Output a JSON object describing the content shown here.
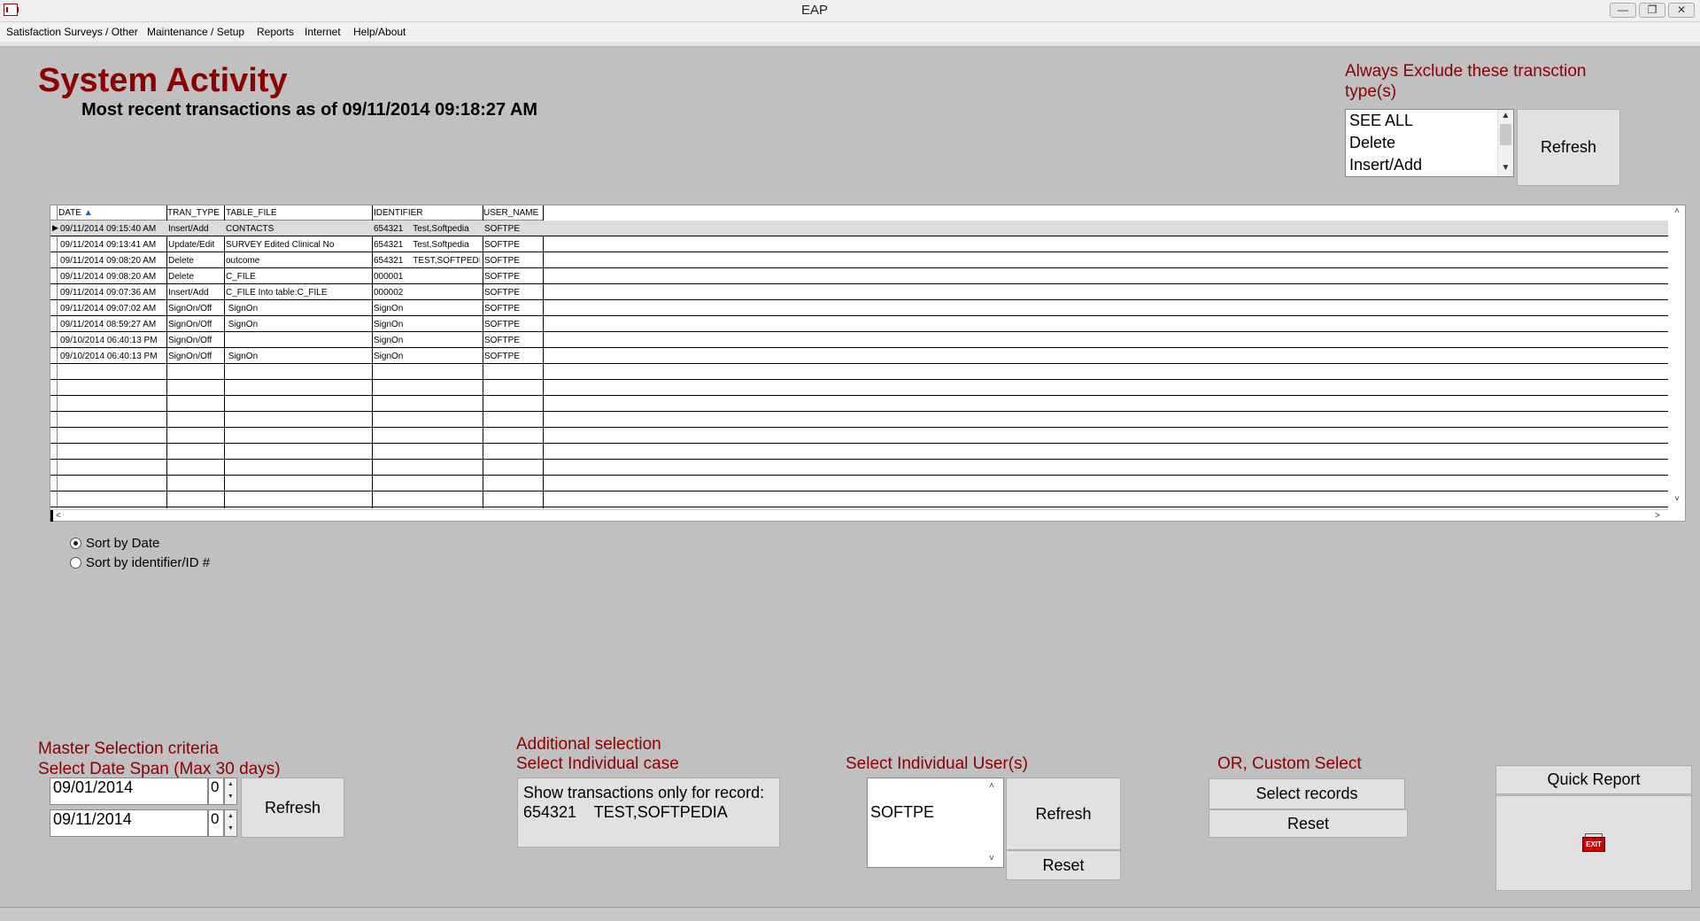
{
  "window": {
    "title": "EAP"
  },
  "menu": [
    "Satisfaction Surveys / Other",
    "Maintenance / Setup",
    "Reports",
    "Internet",
    "Help/About"
  ],
  "header": {
    "title": "System Activity",
    "subtitle": "Most recent transactions as of 09/11/2014 09:18:27 AM"
  },
  "exclude": {
    "label": "Always Exclude these transction type(s)",
    "options": [
      "SEE ALL",
      "Delete",
      "Insert/Add"
    ],
    "refresh_label": "Refresh"
  },
  "grid": {
    "columns": [
      "DATE",
      "TRAN_TYPE",
      "TABLE_FILE",
      "IDENTIFIER",
      "USER_NAME"
    ],
    "rows": [
      [
        "09/11/2014 09:15:40 AM",
        "Insert/Add",
        "CONTACTS",
        "654321    Test,Softpedia",
        "SOFTPE"
      ],
      [
        "09/11/2014 09:13:41 AM",
        "Update/Edit",
        "SURVEY Edited Clinical No",
        "654321    Test,Softpedia",
        "SOFTPE"
      ],
      [
        "09/11/2014 09:08:20 AM",
        "Delete",
        "outcome",
        "654321    TEST,SOFTPEDI",
        "SOFTPE"
      ],
      [
        "09/11/2014 09:08:20 AM",
        "Delete",
        "C_FILE",
        "000001",
        "SOFTPE"
      ],
      [
        "09/11/2014 09:07:36 AM",
        "Insert/Add",
        "C_FILE Into table:C_FILE",
        "000002",
        "SOFTPE"
      ],
      [
        "09/11/2014 09:07:02 AM",
        "SignOn/Off",
        " SignOn",
        "SignOn",
        "SOFTPE"
      ],
      [
        "09/11/2014 08:59:27 AM",
        "SignOn/Off",
        " SignOn",
        "SignOn",
        "SOFTPE"
      ],
      [
        "09/10/2014 06:40:13 PM",
        "SignOn/Off",
        "",
        "SignOn",
        "SOFTPE"
      ],
      [
        "09/10/2014 06:40:13 PM",
        "SignOn/Off",
        " SignOn",
        "SignOn",
        "SOFTPE"
      ]
    ],
    "empty_rows": 9
  },
  "sort": {
    "by_date": "Sort by Date",
    "by_identifier": "Sort by identifier/ID #",
    "selected": "by_date"
  },
  "master": {
    "label1": "Master Selection criteria",
    "label2": "Select Date Span (Max 30 days)",
    "from_date": "09/01/2014",
    "to_date": "09/11/2014",
    "from_offset": "0",
    "to_offset": "0",
    "refresh_label": "Refresh"
  },
  "additional": {
    "label1": "Additional selection",
    "label2": "Select Individual case",
    "line1": "Show transactions only for record:",
    "line2": "654321    TEST,SOFTPEDIA"
  },
  "users": {
    "label": "Select Individual User(s)",
    "options": [
      "SOFTPE"
    ],
    "refresh_label": "Refresh",
    "reset_label": "Reset"
  },
  "custom": {
    "label": "OR, Custom Select",
    "select_label": "Select records",
    "reset_label": "Reset"
  },
  "quick_report_label": "Quick Report",
  "exit_icon_text": "EXIT"
}
